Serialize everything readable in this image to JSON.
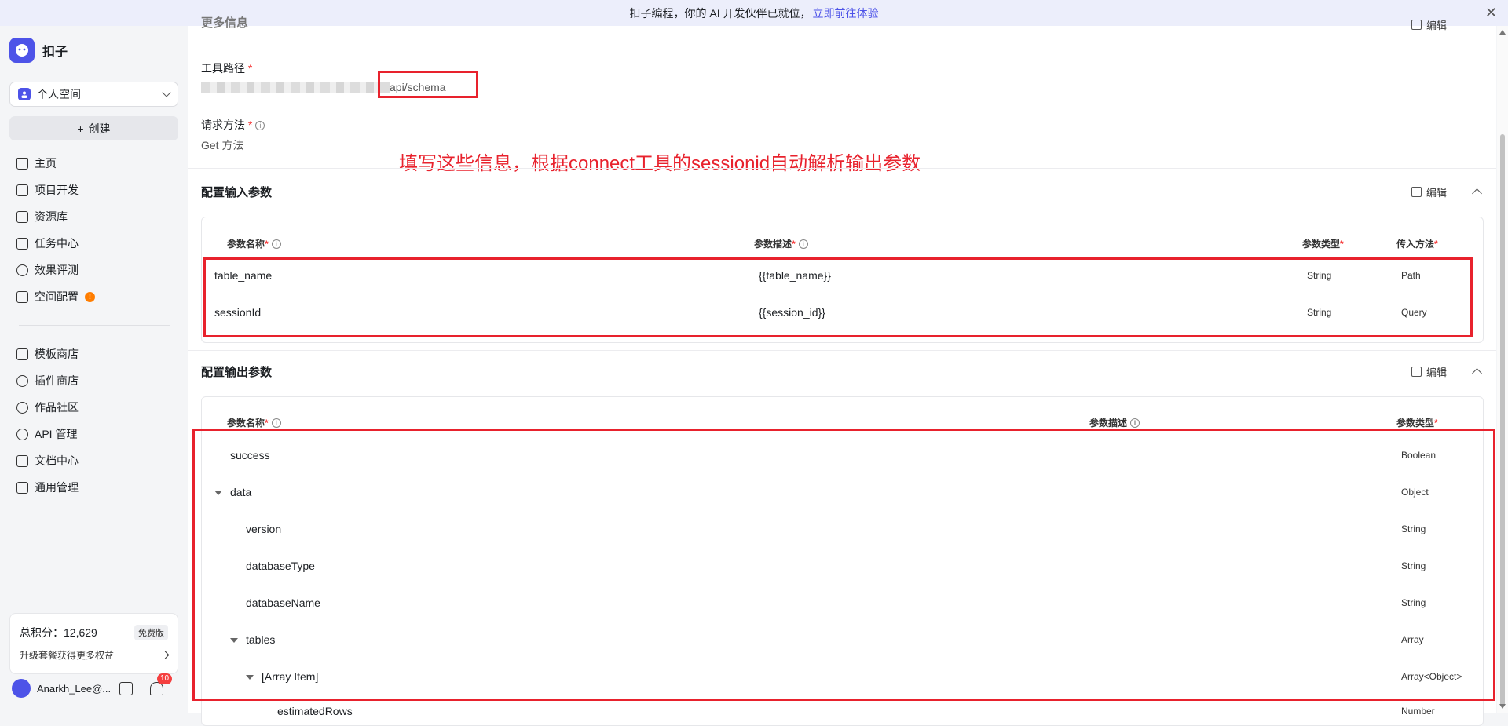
{
  "banner": {
    "text": "扣子编程，你的 AI 开发伙伴已就位，",
    "link": "立即前往体验",
    "close": "✕"
  },
  "sidebar": {
    "brand": "扣子",
    "space": "个人空间",
    "create": "创建",
    "nav": [
      "主页",
      "项目开发",
      "资源库",
      "任务中心",
      "效果评测",
      "空间配置"
    ],
    "space_config_badge": "!",
    "nav2": [
      "模板商店",
      "插件商店",
      "作品社区",
      "API 管理",
      "文档中心",
      "通用管理"
    ],
    "points_label": "总积分：12,629",
    "free_tag": "免费版",
    "upgrade": "升级套餐获得更多权益",
    "user": "Anarkh_Lee@...",
    "notif_count": "10"
  },
  "main": {
    "more_info": "更多信息",
    "top_edit": "编辑",
    "tool_path_label": "工具路径",
    "tool_path_value": "api/schema",
    "req_method_label": "请求方法",
    "req_method_value": "Get 方法",
    "annotation": "填写这些信息，根据connect工具的sessionid自动解析输出参数",
    "input_section": {
      "title": "配置输入参数",
      "edit": "编辑",
      "headers": [
        "参数名称",
        "参数描述",
        "参数类型",
        "传入方法"
      ],
      "rows": [
        [
          "table_name",
          "{{table_name}}",
          "String",
          "Path"
        ],
        [
          "sessionId",
          "{{session_id}}",
          "String",
          "Query"
        ]
      ]
    },
    "output_section": {
      "title": "配置输出参数",
      "edit": "编辑",
      "headers": [
        "参数名称",
        "参数描述",
        "参数类型"
      ],
      "rows": [
        [
          "success",
          "Boolean"
        ],
        [
          "data",
          "Object"
        ],
        [
          "version",
          "String"
        ],
        [
          "databaseType",
          "String"
        ],
        [
          "databaseName",
          "String"
        ],
        [
          "tables",
          "Array"
        ],
        [
          "[Array Item]",
          "Array<Object>"
        ],
        [
          "estimatedRows",
          "Number"
        ]
      ]
    }
  }
}
